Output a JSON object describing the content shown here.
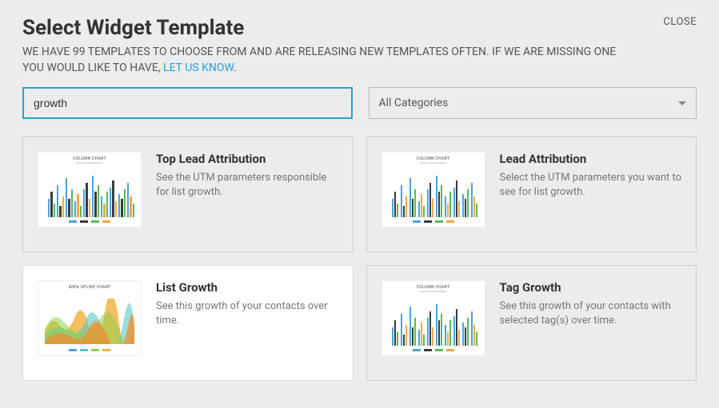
{
  "close_label": "CLOSE",
  "title": "Select Widget Template",
  "subtitle_part1": "WE HAVE 99 TEMPLATES TO CHOOSE FROM AND ARE RELEASING NEW TEMPLATES OFTEN. IF WE ARE MISSING ONE YOU WOULD LIKE TO HAVE, ",
  "subtitle_link": "LET US KNOW",
  "subtitle_part2": ".",
  "search_value": "growth",
  "category_selected": "All Categories",
  "templates": [
    {
      "title": "Top Lead Attribution",
      "desc": "See the UTM parameters responsible for list growth.",
      "thumb_type": "column",
      "thumb_label": "COLUMN CHART",
      "selected": false
    },
    {
      "title": "Lead Attribution",
      "desc": "Select the UTM parameters you want to see for list growth.",
      "thumb_type": "column",
      "thumb_label": "COLUMN CHART",
      "selected": false
    },
    {
      "title": "List Growth",
      "desc": "See this growth of your contacts over time.",
      "thumb_type": "area",
      "thumb_label": "AREA SPLINE CHART",
      "selected": true
    },
    {
      "title": "Tag Growth",
      "desc": "See this growth of your contacts with selected tag(s) over time.",
      "thumb_type": "column",
      "thumb_label": "COLUMN CHART",
      "selected": false
    }
  ]
}
